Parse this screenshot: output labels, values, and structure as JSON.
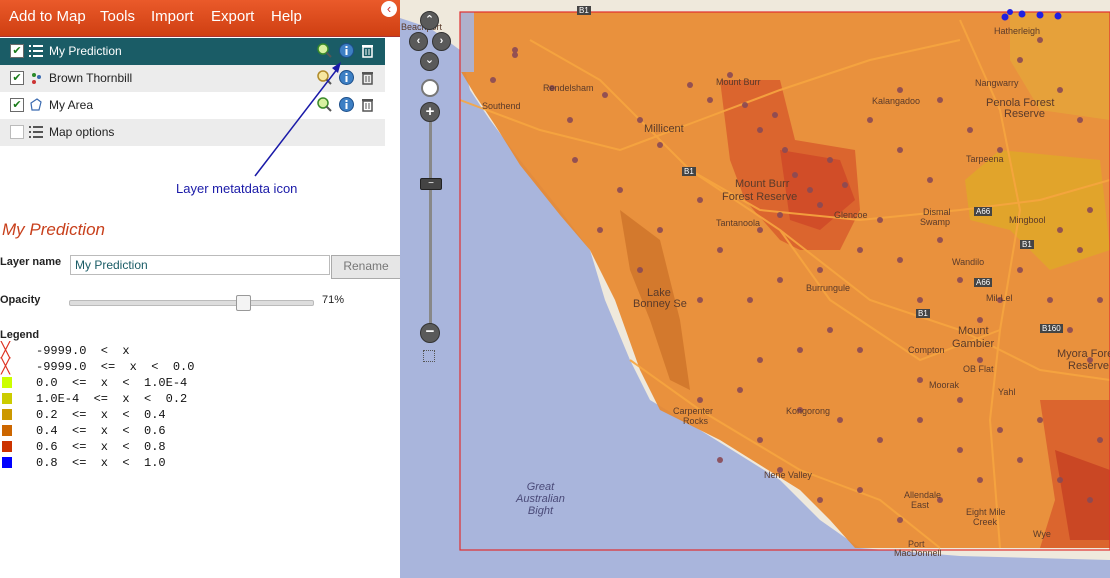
{
  "menu": [
    "Add to Map",
    "Tools",
    "Import",
    "Export",
    "Help"
  ],
  "collapse_glyph": "‹",
  "layers": [
    {
      "name": "My Prediction",
      "checked": true,
      "icon": "list-icon"
    },
    {
      "name": "Brown Thornbill",
      "checked": true,
      "icon": "points-icon"
    },
    {
      "name": "My Area",
      "checked": true,
      "icon": "area-icon"
    },
    {
      "name": "Map options",
      "checked": false,
      "icon": "list-icon"
    }
  ],
  "callout": "Layer metatdata icon",
  "detail": {
    "title": "My Prediction",
    "layer_name_label": "Layer name",
    "layer_name_value": "My Prediction",
    "rename_label": "Rename",
    "opacity_label": "Opacity",
    "opacity_value": "71%",
    "opacity_fraction": 0.71,
    "legend_title": "Legend"
  },
  "legend": [
    {
      "text": "-9999.0  <  x",
      "swatch": "x",
      "color": "#d32"
    },
    {
      "text": "-9999.0  <=  x  <  0.0",
      "swatch": "x",
      "color": "#d32"
    },
    {
      "text": "0.0  <=  x  <  1.0E-4",
      "swatch": "box",
      "color": "#ccff00"
    },
    {
      "text": "1.0E-4  <=  x  <  0.2",
      "swatch": "box",
      "color": "#cccc00"
    },
    {
      "text": "0.2  <=  x  <  0.4",
      "swatch": "box",
      "color": "#cc9900"
    },
    {
      "text": "0.4  <=  x  <  0.6",
      "swatch": "box",
      "color": "#cc6600"
    },
    {
      "text": "0.6  <=  x  <  0.8",
      "swatch": "box",
      "color": "#cc3300"
    },
    {
      "text": "0.8  <=  x  <  1.0",
      "swatch": "box",
      "color": "#0000ff"
    }
  ],
  "map": {
    "place_labels": [
      "Hatherleigh",
      "Rendelsham",
      "Mount Burr",
      "Kalangadoo",
      "Nangwarry",
      "Penola Forest",
      "Reserve",
      "Southend",
      "Millicent",
      "Tarpeena",
      "Mount Burr",
      "Forest Reserve",
      "Beachport",
      "Tantanoola",
      "Glencoe",
      "Dismal",
      "Swamp",
      "Mingbool",
      "Wandilo",
      "Burrungule",
      "Mil-Lel",
      "Compton",
      "Mount",
      "Gambier",
      "OB Flat",
      "Myora Forest",
      "Reserve",
      "Moorak",
      "Yahl",
      "Kongorong",
      "Carpenter",
      "Rocks",
      "Allendale",
      "East",
      "Eight Mile",
      "Creek",
      "Port",
      "MacDonnell",
      "Wye",
      "Nene Valley",
      "Lake",
      "Bonney Se"
    ],
    "sea_label": "Great\nAustralian\nBight",
    "road_labels": [
      "B1",
      "A66",
      "B1",
      "A66",
      "B1",
      "B160",
      "B1"
    ]
  }
}
